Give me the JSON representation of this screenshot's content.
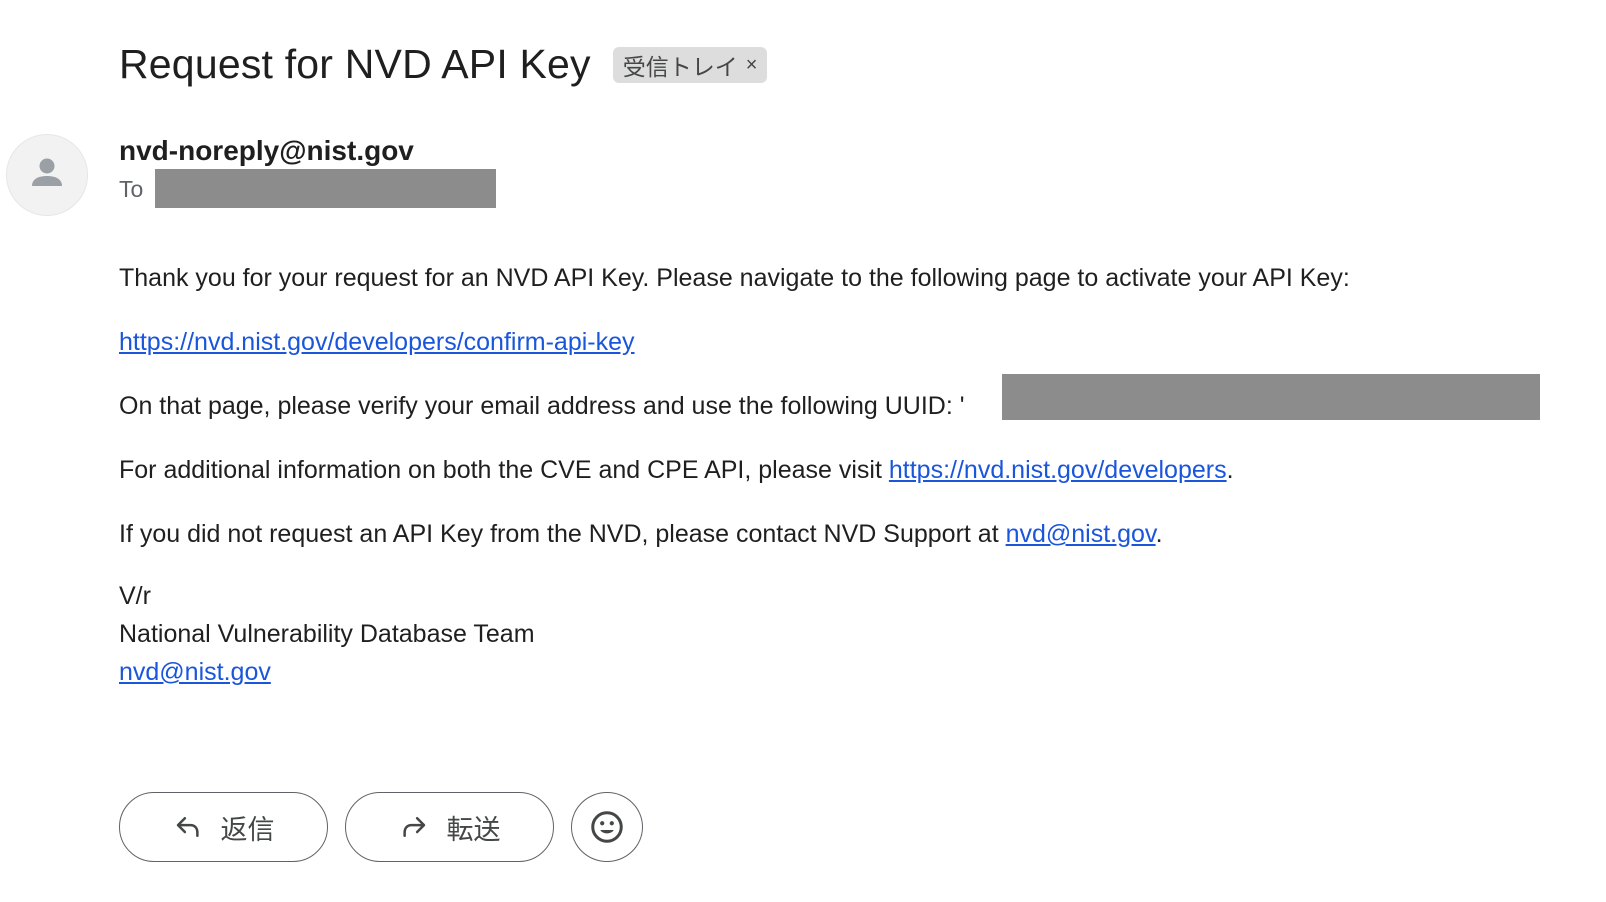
{
  "email": {
    "subject": "Request for NVD API Key",
    "label_chip": {
      "text": "受信トレイ",
      "remove": "×"
    },
    "sender": "nvd-noreply@nist.gov",
    "to_label": "To",
    "body": {
      "intro": "Thank you for your request for an NVD API Key. Please navigate to the following page to activate your API Key:",
      "confirm_link": "https://nvd.nist.gov/developers/confirm-api-key",
      "uuid_text": "On that page, please verify your email address and use the following UUID:",
      "uuid_partial": "'",
      "additional_prefix": "For additional information on both the CVE and CPE API, please visit",
      "developers_link": "https://nvd.nist.gov/developers",
      "additional_suffix": ".",
      "contact_prefix": "If you did not request an API Key from the NVD, please contact NVD Support at",
      "contact_link": "nvd@nist.gov",
      "contact_suffix": ".",
      "signoff": "V/r",
      "team": "National Vulnerability Database Team",
      "signature_link": "nvd@nist.gov"
    },
    "actions": {
      "reply_label": "返信",
      "forward_label": "転送"
    }
  }
}
